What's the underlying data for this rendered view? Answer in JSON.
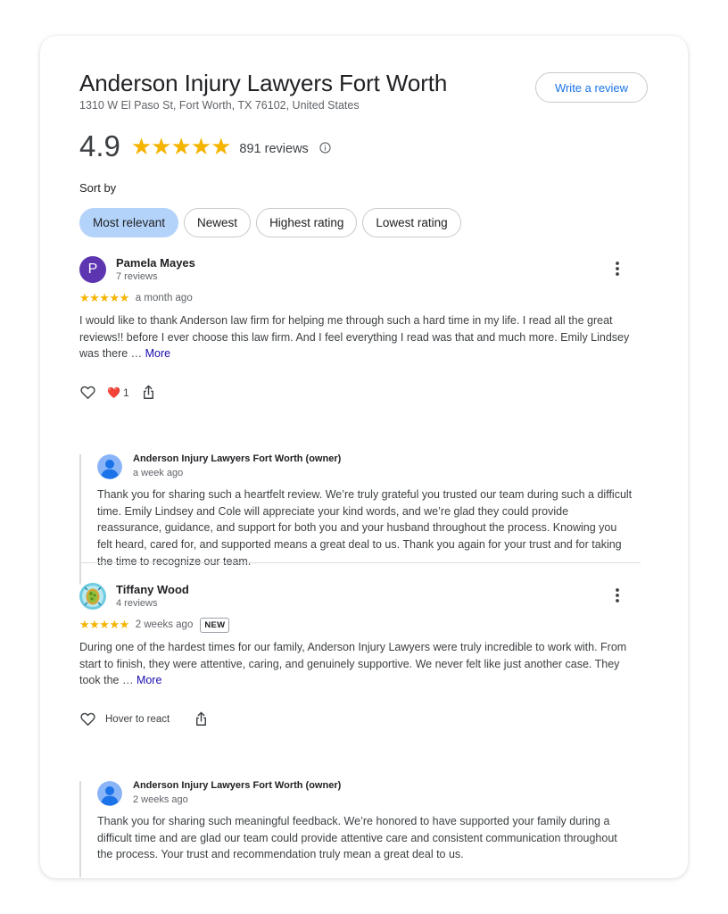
{
  "business": {
    "name": "Anderson Injury Lawyers Fort Worth",
    "address": "1310 W El Paso St, Fort Worth, TX 76102, United States",
    "write_review_label": "Write a review",
    "rating": "4.9",
    "stars": "★★★★★",
    "review_count": "891 reviews"
  },
  "sort": {
    "label": "Sort by",
    "options": [
      "Most relevant",
      "Newest",
      "Highest rating",
      "Lowest rating"
    ],
    "selected": "Most relevant"
  },
  "reviews": [
    {
      "avatar_letter": "P",
      "author": "Pamela Mayes",
      "author_reviews": "7 reviews",
      "stars": "★★★★★",
      "rating": 5,
      "time": "a month ago",
      "text": "I would like to thank Anderson law firm for helping me through such a hard time in my life. I read all the great reviews!! before I ever choose this law firm. And I feel everything I read was that and much more. Emily Lindsey was there … ",
      "more_label": "More",
      "reaction_emoji": "❤️",
      "reaction_count": "1",
      "owner_reply": {
        "name": "Anderson Injury Lawyers Fort Worth (owner)",
        "time": "a week ago",
        "text": "Thank you for sharing such a heartfelt review. We’re truly grateful you trusted our team during such a difficult time. Emily Lindsey and Cole will appreciate your kind words, and we’re glad they could provide reassurance, guidance, and support for both you and your husband throughout the process. Knowing you felt heard, cared for, and supported means a great deal to us. Thank you again for your trust and for taking the time to recognize our team."
      }
    },
    {
      "author": "Tiffany Wood",
      "author_reviews": "4 reviews",
      "stars": "★★★★★",
      "rating": 5,
      "time": "2 weeks ago",
      "badge": "NEW",
      "text": "During one of the hardest times for our family, Anderson Injury Lawyers were truly incredible to work with. From start to finish, they were attentive, caring, and genuinely supportive. We never felt like just another case. They took the … ",
      "more_label": "More",
      "hover_react_label": "Hover to react",
      "owner_reply": {
        "name": "Anderson Injury Lawyers Fort Worth (owner)",
        "time": "2 weeks ago",
        "text": "Thank you for sharing such meaningful feedback. We’re honored to have supported your family during a difficult time and are glad our team could provide attentive care and consistent communication throughout the process. Your trust and recommendation truly mean a great deal to us."
      }
    }
  ],
  "icons": {
    "info": "info-icon",
    "more": "more-vert-icon",
    "like": "heart-outline-icon",
    "share": "share-icon",
    "owner_avatar": "person-icon"
  },
  "colors": {
    "star": "#f5b400",
    "accent": "#1a73e8",
    "chip_active": "#b3d3fb",
    "avatar_purple": "#5e35b1"
  }
}
